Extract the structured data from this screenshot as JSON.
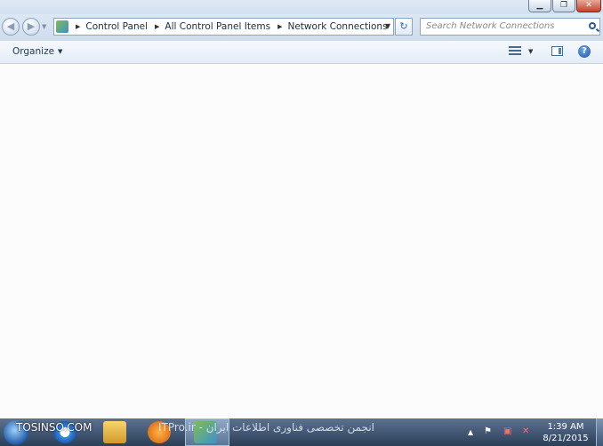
{
  "window": {
    "minimize_glyph": "▁",
    "maximize_glyph": "❐",
    "close_glyph": "✕"
  },
  "nav": {
    "back_glyph": "◀",
    "forward_glyph": "▶",
    "dropdown_glyph": "▼",
    "breadcrumbs": [
      "Control Panel",
      "All Control Panel Items",
      "Network Connections"
    ],
    "refresh_glyph": "↻",
    "search_placeholder": "Search Network Connections"
  },
  "toolbar": {
    "organize_label": "Organize",
    "help_glyph": "?"
  },
  "taskbar": {
    "watermark_left": "TOSINSO.COM",
    "watermark_center": "انجمن تخصصی فناوری اطلاعات ایران - ITPro.ir",
    "clock_time": "1:39 AM",
    "clock_date": "8/21/2015"
  },
  "icons": [
    "control-panel-icon",
    "search-icon",
    "view-options-icon",
    "preview-pane-icon",
    "help-icon",
    "start-orb-icon",
    "internet-explorer-icon",
    "windows-explorer-icon",
    "media-player-icon",
    "network-tray-icon",
    "volume-tray-icon",
    "action-center-flag-icon"
  ],
  "colors": {
    "chrome": "#d3e0ef",
    "close_button": "#c0432c",
    "taskbar": "#2c3f58"
  }
}
